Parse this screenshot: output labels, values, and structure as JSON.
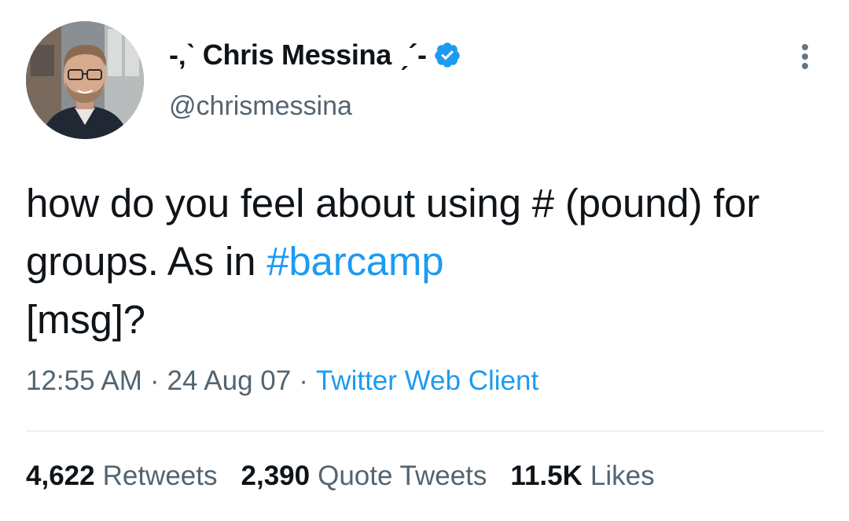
{
  "author": {
    "display_name": "-‚ˋ Chris Messina ˏ´-",
    "handle": "@chrismessina",
    "verified_icon": "verified-badge-icon",
    "avatar_icon": "profile-photo"
  },
  "tweet": {
    "text_plain": "how do you feel about using # (pound) for groups. As in",
    "hashtag": "#barcamp",
    "text_tail": "[msg]?"
  },
  "meta": {
    "time": "12:55 AM",
    "date": "24 Aug 07",
    "separator": "·",
    "client": "Twitter Web Client"
  },
  "stats": {
    "retweets_count": "4,622",
    "retweets_label": "Retweets",
    "quotes_count": "2,390",
    "quotes_label": "Quote Tweets",
    "likes_count": "11.5K",
    "likes_label": "Likes"
  },
  "colors": {
    "link": "#1d9bf0",
    "text": "#0f1419",
    "secondary": "#536471",
    "divider": "#dfe3e6"
  },
  "icons": {
    "more": "more-vertical-icon"
  }
}
